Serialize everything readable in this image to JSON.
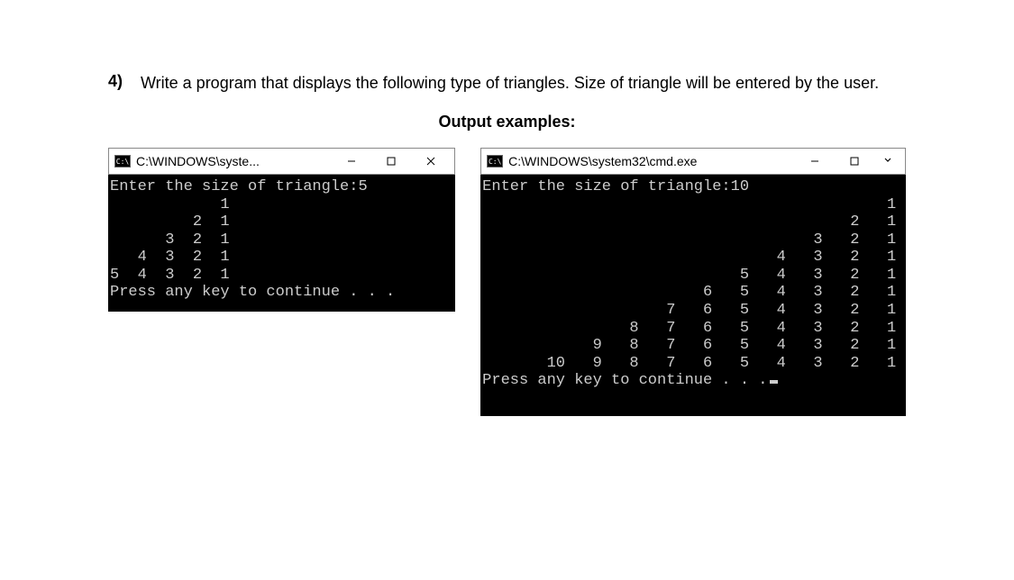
{
  "question": {
    "number": "4)",
    "text": "Write a program that displays the following type of triangles. Size of triangle will be entered by the user."
  },
  "examples_title": "Output examples:",
  "window1": {
    "title": "C:\\WINDOWS\\syste...",
    "icon_label": "C:\\",
    "body_lines": [
      "Enter the size of triangle:5",
      "            1",
      "         2  1",
      "      3  2  1",
      "   4  3  2  1",
      "5  4  3  2  1",
      "Press any key to continue . . ."
    ]
  },
  "window2": {
    "title": "C:\\WINDOWS\\system32\\cmd.exe",
    "icon_label": "C:\\",
    "body_lines": [
      "Enter the size of triangle:10",
      "                                            1",
      "                                        2   1",
      "                                    3   2   1",
      "                                4   3   2   1",
      "                            5   4   3   2   1",
      "                        6   5   4   3   2   1",
      "                    7   6   5   4   3   2   1",
      "                8   7   6   5   4   3   2   1",
      "            9   8   7   6   5   4   3   2   1",
      "       10   9   8   7   6   5   4   3   2   1",
      "Press any key to continue . . ."
    ]
  }
}
